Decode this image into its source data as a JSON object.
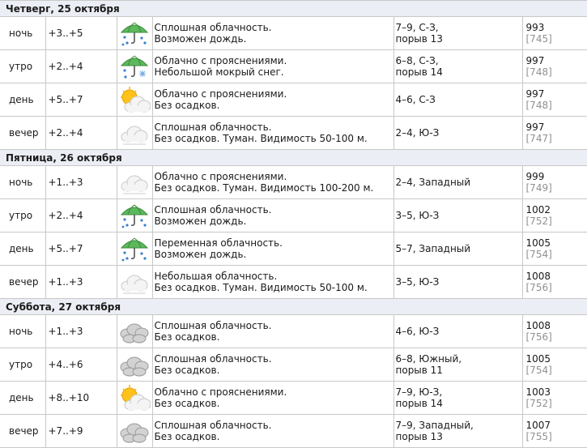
{
  "days": [
    {
      "title": "Четверг, 25 октября",
      "rows": [
        {
          "tod": "ночь",
          "temp": "+3..+5",
          "icon": "umbrella-rain-icon",
          "desc": [
            "Сплошная облачность.",
            "Возможен дождь."
          ],
          "wind": [
            "7–9, С-З,",
            "порыв 13"
          ],
          "pressure": "993",
          "pressure_mm": "[745]"
        },
        {
          "tod": "утро",
          "temp": "+2..+4",
          "icon": "umbrella-snow-icon",
          "desc": [
            "Облачно с прояснениями.",
            "Небольшой мокрый снег."
          ],
          "wind": [
            "6–8, С-З,",
            "порыв 14"
          ],
          "pressure": "997",
          "pressure_mm": "[748]"
        },
        {
          "tod": "день",
          "temp": "+5..+7",
          "icon": "sun-cloud-icon",
          "desc": [
            "Облачно с прояснениями.",
            "Без осадков."
          ],
          "wind": [
            "4–6, С-З"
          ],
          "pressure": "997",
          "pressure_mm": "[748]"
        },
        {
          "tod": "вечер",
          "temp": "+2..+4",
          "icon": "fog-cloud-icon",
          "desc": [
            "Сплошная облачность.",
            "Без осадков. Туман. Видимость 50-100 м."
          ],
          "wind": [
            "2–4, Ю-З"
          ],
          "pressure": "997",
          "pressure_mm": "[747]"
        }
      ]
    },
    {
      "title": "Пятница, 26 октября",
      "rows": [
        {
          "tod": "ночь",
          "temp": "+1..+3",
          "icon": "fog-cloud-icon",
          "desc": [
            "Облачно с прояснениями.",
            "Без осадков. Туман. Видимость 100-200 м."
          ],
          "wind": [
            "2–4, Западный"
          ],
          "pressure": "999",
          "pressure_mm": "[749]"
        },
        {
          "tod": "утро",
          "temp": "+2..+4",
          "icon": "umbrella-rain-icon",
          "desc": [
            "Сплошная облачность.",
            "Возможен дождь."
          ],
          "wind": [
            "3–5, Ю-З"
          ],
          "pressure": "1002",
          "pressure_mm": "[752]"
        },
        {
          "tod": "день",
          "temp": "+5..+7",
          "icon": "umbrella-rain-icon",
          "desc": [
            "Переменная облачность.",
            "Возможен дождь."
          ],
          "wind": [
            "5–7, Западный"
          ],
          "pressure": "1005",
          "pressure_mm": "[754]"
        },
        {
          "tod": "вечер",
          "temp": "+1..+3",
          "icon": "fog-cloud-icon",
          "desc": [
            "Небольшая облачность.",
            "Без осадков. Туман. Видимость 50-100 м."
          ],
          "wind": [
            "3–5, Ю-З"
          ],
          "pressure": "1008",
          "pressure_mm": "[756]"
        }
      ]
    },
    {
      "title": "Суббота, 27 октября",
      "rows": [
        {
          "tod": "ночь",
          "temp": "+1..+3",
          "icon": "overcast-cloud-icon",
          "desc": [
            "Сплошная облачность.",
            "Без осадков."
          ],
          "wind": [
            "4–6, Ю-З"
          ],
          "pressure": "1008",
          "pressure_mm": "[756]"
        },
        {
          "tod": "утро",
          "temp": "+4..+6",
          "icon": "overcast-cloud-icon",
          "desc": [
            "Сплошная облачность.",
            "Без осадков."
          ],
          "wind": [
            "6–8, Южный,",
            "порыв 11"
          ],
          "pressure": "1005",
          "pressure_mm": "[754]"
        },
        {
          "tod": "день",
          "temp": "+8..+10",
          "icon": "sun-cloud-icon",
          "desc": [
            "Облачно с прояснениями.",
            "Без осадков."
          ],
          "wind": [
            "7–9, Ю-З,",
            "порыв 14"
          ],
          "pressure": "1003",
          "pressure_mm": "[752]"
        },
        {
          "tod": "вечер",
          "temp": "+7..+9",
          "icon": "overcast-cloud-icon",
          "desc": [
            "Сплошная облачность.",
            "Без осадков."
          ],
          "wind": [
            "7–9, Западный,",
            "порыв 13"
          ],
          "pressure": "1007",
          "pressure_mm": "[755]"
        }
      ]
    }
  ]
}
